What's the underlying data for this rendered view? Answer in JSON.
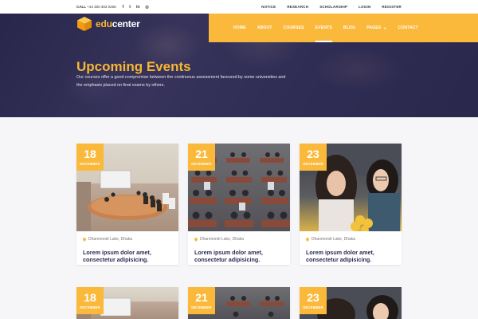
{
  "topbar": {
    "call_label": "CALL",
    "phone": "+44 300 303 0266",
    "social_icons": [
      "facebook-icon",
      "twitter-icon",
      "linkedin-icon",
      "instagram-icon"
    ],
    "social_glyphs": [
      "f",
      "t",
      "in",
      "◎"
    ],
    "links": [
      "NOTICE",
      "RESEARCH",
      "SCHOLARSHIP",
      "LOGIN",
      "REGISTER"
    ]
  },
  "brand": {
    "name_part1": "edu",
    "name_part2": "center",
    "accent_color": "#fbb93c"
  },
  "nav": {
    "items": [
      "HOME",
      "ABOUT",
      "COURSES",
      "EVENTS",
      "BLOG",
      "PAGES",
      "CONTACT"
    ],
    "active": "EVENTS"
  },
  "hero": {
    "title": "Upcoming Events",
    "description": "Our courses offer a good compromise between the continuous assessment favoured by some universities and the emphasis placed on final exams by others."
  },
  "events": [
    {
      "day": "18",
      "month": "DECEMBER",
      "location": "Dhanmondi Lake, Dhaka",
      "title": "Lorem ipsum dolor amet, consectetur adipisicing."
    },
    {
      "day": "21",
      "month": "DECEMBER",
      "location": "Dhanmondi Lake, Dhaka",
      "title": "Lorem ipsum dolor amet, consectetur adipisicing."
    },
    {
      "day": "23",
      "month": "DECEMBER",
      "location": "Dhanmondi Lake, Dhaka",
      "title": "Lorem ipsum dolor amet, consectetur adipisicing."
    },
    {
      "day": "18",
      "month": "DECEMBER"
    },
    {
      "day": "21",
      "month": "DECEMBER"
    },
    {
      "day": "23",
      "month": "DECEMBER"
    }
  ]
}
